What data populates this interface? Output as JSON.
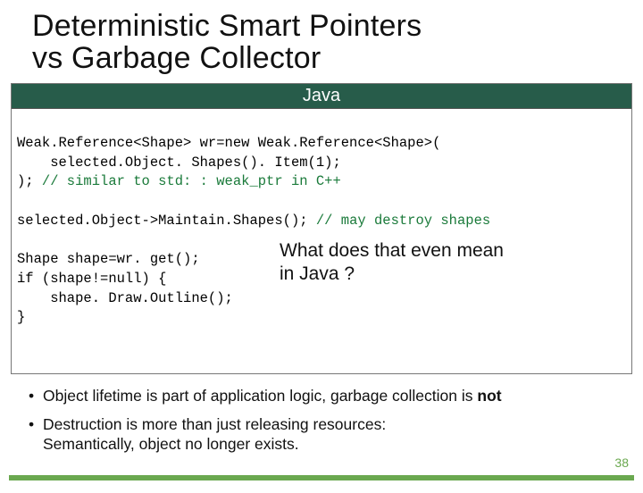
{
  "title_line1": "Deterministic Smart Pointers",
  "title_line2": "vs Garbage Collector",
  "code_header": "Java",
  "code": {
    "l1": "Weak.Reference<Shape> wr=new Weak.Reference<Shape>(",
    "l2": "    selected.Object. Shapes(). Item(1);",
    "l3a": "); ",
    "l3b": "// similar to std: : weak_ptr in C++",
    "l4a": "selected.Object->Maintain.Shapes(); ",
    "l4b": "// may destroy shapes",
    "l5": "Shape shape=wr. get();",
    "l6": "if (shape!=null) {",
    "l7": "    shape. Draw.Outline();",
    "l8": "}"
  },
  "annotation_line1": "What does that even mean",
  "annotation_line2": "in Java ?",
  "bullets": {
    "b1_prefix": "Object lifetime is part of application logic, garbage collection is ",
    "b1_bold": "not",
    "b2_line1": "Destruction is more than just releasing resources:",
    "b2_line2": "Semantically, object no longer exists."
  },
  "page_number": "38"
}
